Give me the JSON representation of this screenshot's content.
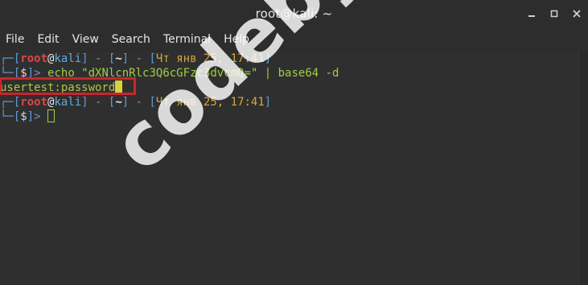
{
  "window": {
    "title": "root@kali: ~"
  },
  "menu": [
    "File",
    "Edit",
    "View",
    "Search",
    "Terminal",
    "Help"
  ],
  "terminal": {
    "prompt1": {
      "open": "┌─[",
      "user": "root",
      "at": "@",
      "host": "kali",
      "close": "]",
      "sep1": " - [",
      "cwd": "~",
      "sep2": "] - [",
      "datetime": "Чт янв 25, 17:41",
      "end": "]"
    },
    "cmd_line": {
      "prefix": "└─[",
      "sym": "$",
      "suffix": "]> ",
      "command": "echo \"dXNlcnRlc3Q6cGFzc3dvcmQ=\" | base64 -d"
    },
    "output": "usertest:password",
    "prompt2": {
      "open": "┌─[",
      "user": "root",
      "at": "@",
      "host": "kali",
      "close": "]",
      "sep1": " - [",
      "cwd": "~",
      "sep2": "] - [",
      "datetime": "Чт янв 25, 17:41",
      "end": "]"
    },
    "cmd_line2": {
      "prefix": "└─[",
      "sym": "$",
      "suffix": "]> "
    }
  },
  "watermark": "codeby.net",
  "colors": {
    "highlight": "#d4202a",
    "accent_green": "#9fcf3e",
    "accent_blue": "#5d9bd8"
  }
}
